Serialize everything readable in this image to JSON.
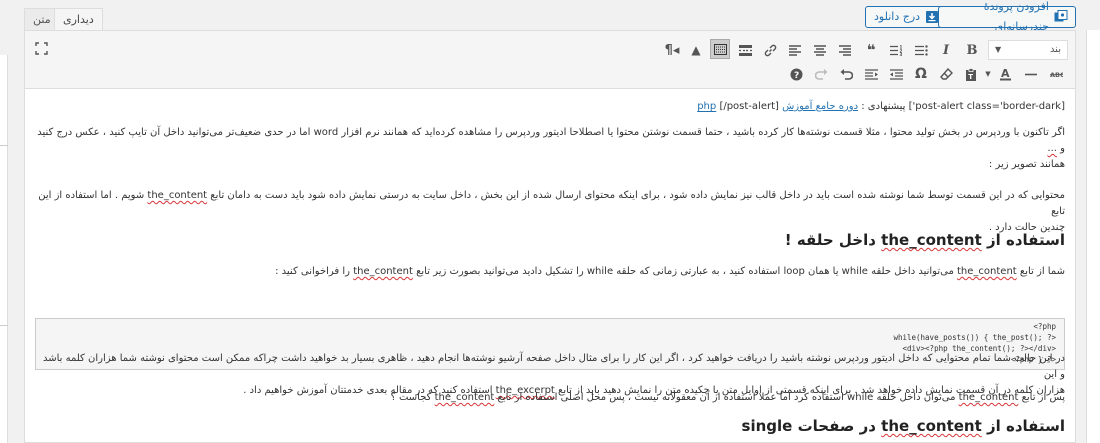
{
  "tabs": {
    "visual": "دیداری",
    "text": "متن"
  },
  "media_buttons": {
    "add_media": "افزودن پروندهٔ چندرسانه‌ای",
    "insert_download": "درج دانلود"
  },
  "toolbar": {
    "format_value": "بند"
  },
  "content": {
    "shortcode_line": {
      "part1": "[post-alert class='border-dark'] پیشنهادی :",
      "link": "دوره جامع آموزش",
      "php": "php",
      "part2": "[/post-alert]"
    },
    "para1": {
      "line1": "اگر تاکنون با وردپرس در بخش تولید محتوا ، مثلا قسمت نوشته‌ها کار کرده باشید ، حتما قسمت نوشتن محتوا یا اصطلاحا ادیتور وردپرس را مشاهده کرده‌اید که همانند نرم افزار word اما در حدی ضعیف‌تر می‌توانید داخل آن تایپ کنید ، عکس درج کنید و",
      "line1_tail": "...",
      "line2": "همانند تصویر زیر :"
    },
    "para2": {
      "line1_a": "محتوایی که در این قسمت توسط شما نوشته شده است باید در داخل قالب نیز نمایش داده شود ، برای اینکه محتوای ارسال شده از این بخش ، داخل سایت به درستی نمایش داده شود باید دست به دامان تابع",
      "line1_code": "the_content",
      "line1_b": "شویم . اما استفاده از این تابع",
      "line2": "چندین حالت دارد ."
    },
    "heading1": {
      "prefix": "استفاده از",
      "code": "the_content",
      "suffix": "داخل حلقه !"
    },
    "para3": {
      "a": "شما از تابع",
      "code1": "the_content",
      "b": "می‌توانید داخل حلقه while یا همان loop استفاده کنید ، به عبارتی زمانی که حلقه while را تشکیل دادید می‌توانید بصورت زیر تابع",
      "code2": "the_content",
      "c": "را فراخوانی کنید :"
    },
    "code": {
      "line1": "<?php",
      "line2": "while(have_posts()) { the_post(); ?>",
      "line3": "<div><?php the_content(); ?></div>",
      "line4": "<?php } ?>"
    },
    "para4": {
      "line1": "در این حالت شما تمام محتوایی که داخل ادیتور وردپرس نوشته باشید را دریافت خواهید کرد ، اگر این کار را برای مثال داخل صفحه آرشیو نوشته‌ها انجام دهید ، ظاهری بسیار بد خواهید داشت چراکه ممکن است محتوای نوشته شما هزاران کلمه باشد و این",
      "line2_a": "هزاران کلمه در آن قسمت نمایش داده خواهد شد . برای اینکه قسمتی از اوایل متن یا چکیده متن را نمایش دهید باید از تابع",
      "line2_code": "the_excerpt",
      "line2_b": "استفاده کنید که در مقاله بعدی خدمتتان آموزش خواهیم داد ."
    },
    "para5": {
      "a": "پس از تابع",
      "code1": "the_content",
      "b": "می‌توان داخل حلقه while استفاده کرد اما عملا استفاده از آن معقولانه نیست ، پس محل اصلی استفاده از تابع",
      "code2": "the_content",
      "c": "کجاست ؟"
    },
    "heading2": {
      "prefix": "استفاده از",
      "code": "the_content",
      "suffix": "در صفحات single"
    }
  }
}
